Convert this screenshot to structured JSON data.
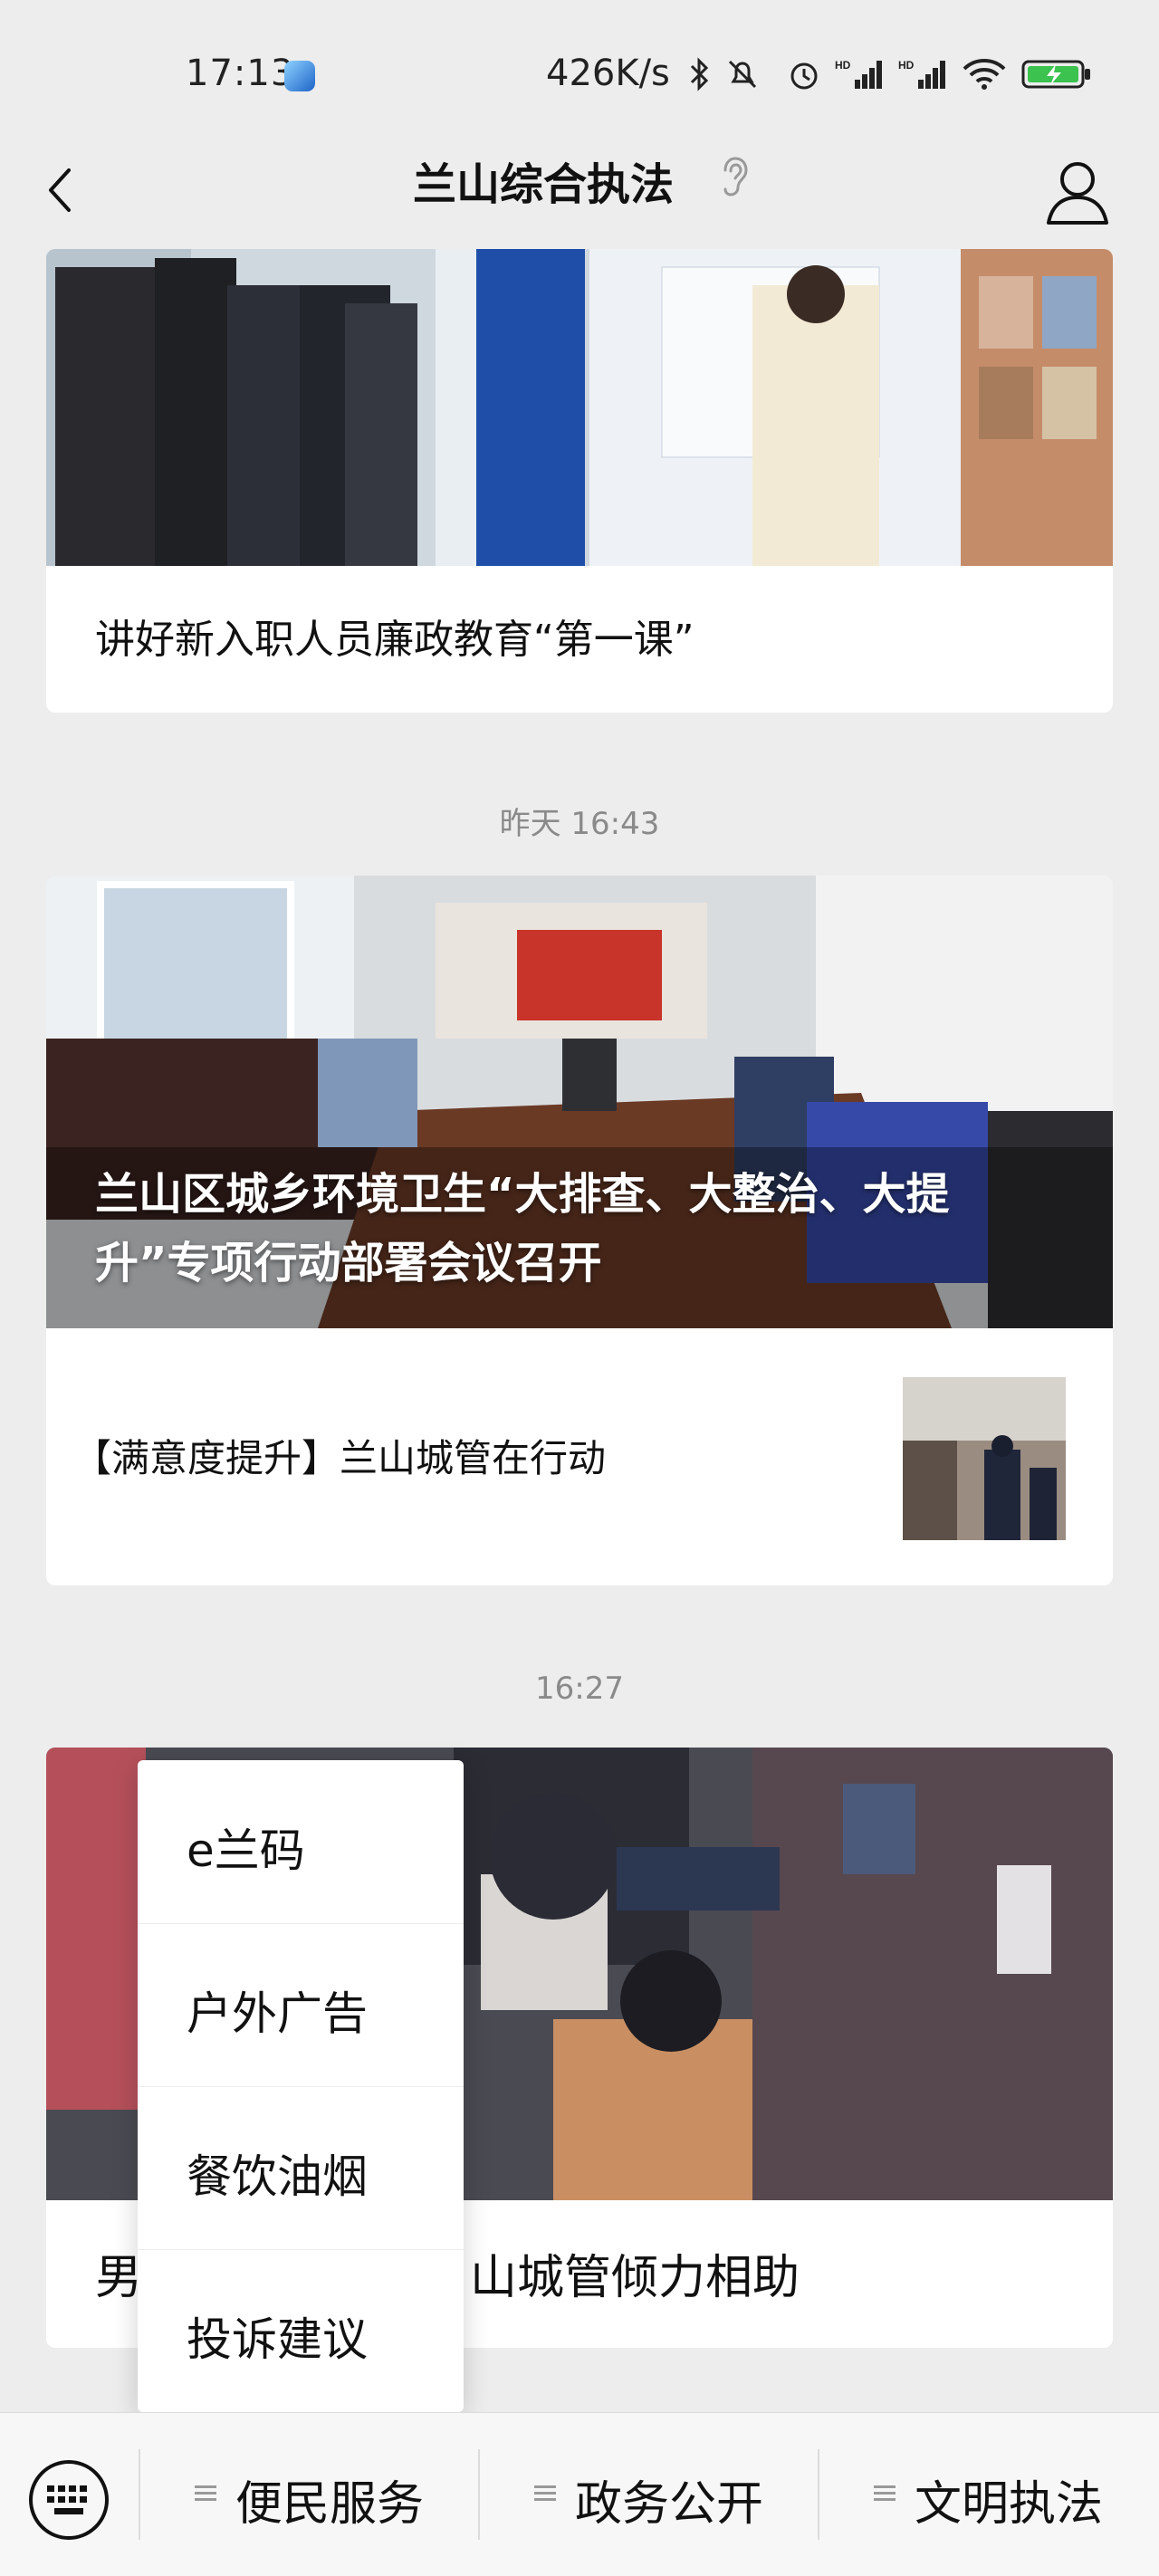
{
  "status_bar": {
    "time": "17:13",
    "speed": "426K/s",
    "icons": [
      "app-icon",
      "bluetooth-icon",
      "mute-icon",
      "alarm-icon",
      "signal-hd-icon",
      "signal-hd-icon",
      "wifi-icon",
      "battery-charging-icon"
    ]
  },
  "nav": {
    "title": "兰山综合执法",
    "icons": [
      "back-icon",
      "ear-icon",
      "user-icon"
    ]
  },
  "feed": [
    {
      "title": "讲好新入职人员廉政教育“第一课”"
    },
    {
      "timestamp": "昨天 16:43",
      "hero_title": "兰山区城乡环境卫生“大排查、大整治、大提升”专项行动部署会议召开",
      "hero_title_line1": "兰山区城乡环境卫生“大排查、大整治、大提",
      "hero_title_line2": "升”专项行动部署会议召开",
      "items": [
        {
          "title": "【满意度提升】兰山城管在行动"
        }
      ]
    },
    {
      "timestamp": "16:27",
      "title_visible_start": "男",
      "title_visible_end": "山城管倾力相助"
    }
  ],
  "popup_menu": {
    "items": [
      "e兰码",
      "户外广告",
      "餐饮油烟",
      "投诉建议"
    ]
  },
  "bottom_menu": {
    "keyboard_icon": "keyboard-icon",
    "buttons": [
      "便民服务",
      "政务公开",
      "文明执法"
    ]
  },
  "colors": {
    "background": "#ededed",
    "card": "#ffffff",
    "timestamp": "#8a8a8a"
  }
}
